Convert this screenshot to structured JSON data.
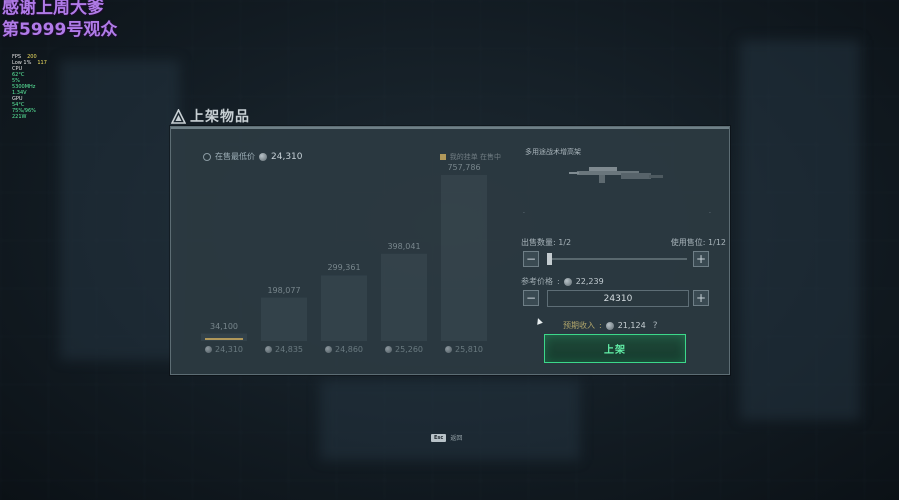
{
  "overlay": {
    "line1": "感谢上周大爹",
    "line2": "第5999号观众"
  },
  "fps_overlay": {
    "rows": [
      [
        "FPS",
        "200"
      ],
      [
        "Low 1%",
        "117"
      ],
      [
        "CPU",
        ""
      ],
      [
        "62°C",
        ""
      ],
      [
        "5%",
        ""
      ],
      [
        "5300MHz",
        ""
      ],
      [
        "1.34V",
        ""
      ],
      [
        "GPU",
        ""
      ],
      [
        "54°C",
        ""
      ],
      [
        "75%/96%",
        ""
      ],
      [
        "221W",
        ""
      ]
    ]
  },
  "panel": {
    "title": "上架物品",
    "lowest_label": "在售最低价",
    "lowest_price": "24,310",
    "legend": "我的挂单   在售中",
    "bars": [
      {
        "qty": "34,100",
        "price": "24,310",
        "highlight": true
      },
      {
        "qty": "198,077",
        "price": "24,835",
        "highlight": false
      },
      {
        "qty": "299,361",
        "price": "24,860",
        "highlight": false
      },
      {
        "qty": "398,041",
        "price": "25,260",
        "highlight": false
      },
      {
        "qty": "757,786",
        "price": "25,810",
        "highlight": false
      }
    ]
  },
  "item": {
    "name": "多用途战术增高架",
    "dots_left": ".",
    "dots_right": "."
  },
  "quantity": {
    "label": "出售数量",
    "value": "1/2",
    "slots_label": "使用售位",
    "slots_value": "1/12",
    "minus": "−",
    "plus": "+",
    "fraction": 0.5
  },
  "price": {
    "ref_label": "参考价格",
    "ref_value": "22,239",
    "input_value": "24310",
    "minus": "−",
    "plus": "+"
  },
  "income": {
    "label": "预期收入",
    "value": "21,124",
    "help": "?"
  },
  "list_button": "上架",
  "esc": {
    "key": "Esc",
    "label": "返回"
  },
  "colors": {
    "accent": "#3cd88a",
    "highlight_bar": "#b0985a"
  }
}
